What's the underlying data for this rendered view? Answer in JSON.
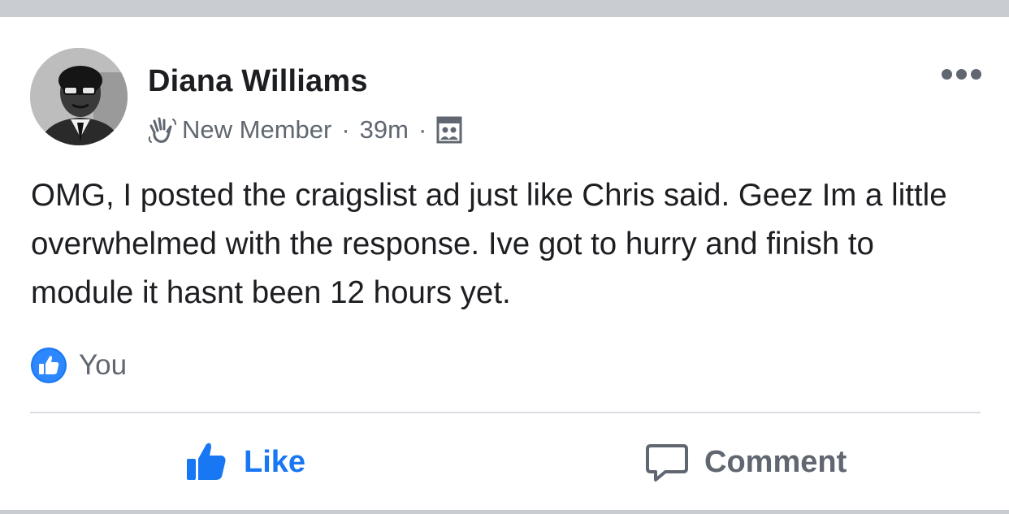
{
  "post": {
    "author": "Diana Williams",
    "badge": "New Member",
    "separator": "·",
    "timestamp": "39m",
    "visibility_icon": "group-icon",
    "body": "OMG, I posted the craigslist ad just like Chris said. Geez Im a little overwhelmed with the response. Ive got to hurry and finish to module it hasnt been 12 hours yet.",
    "reactions": {
      "icon": "like-badge-icon",
      "reactor": "You"
    },
    "actions": {
      "like_label": "Like",
      "comment_label": "Comment"
    }
  },
  "colors": {
    "background": "#ffffff",
    "separator_band": "#c9ccd1",
    "primary_text": "#1c1e21",
    "secondary_text": "#606770",
    "accent_blue": "#1877f2",
    "divider": "#dadde1"
  }
}
